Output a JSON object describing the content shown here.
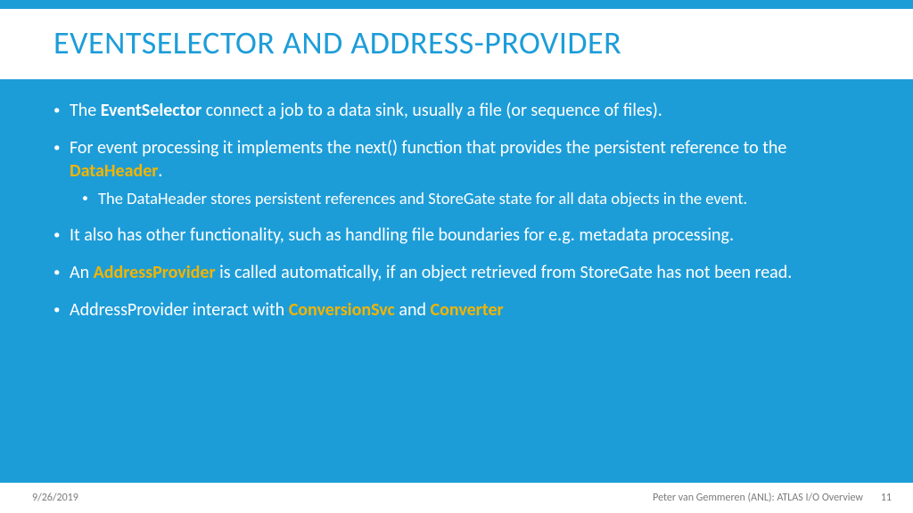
{
  "title": "EVENTSELECTOR AND ADDRESS-PROVIDER",
  "bullets": {
    "b1_pre": "The ",
    "b1_bold": "EventSelector",
    "b1_post": " connect a job to a data sink, usually a file (or sequence of files).",
    "b2_pre": "For event processing it implements the next() function that provides the persistent reference to the ",
    "b2_hl": "DataHeader",
    "b2_post": ".",
    "b2_sub": "The DataHeader stores persistent references and StoreGate state for all data objects in the event.",
    "b3": "It also has other functionality, such as handling file boundaries for e.g. metadata processing.",
    "b4_pre": "An ",
    "b4_hl": "AddressProvider",
    "b4_post": " is called automatically, if an object retrieved from StoreGate has not been read.",
    "b5_pre": "AddressProvider interact with ",
    "b5_hl1": "ConversionSvc",
    "b5_mid": " and ",
    "b5_hl2": "Converter"
  },
  "footer": {
    "date": "9/26/2019",
    "attribution": "Peter van Gemmeren (ANL): ATLAS I/O Overview",
    "page": "11"
  }
}
